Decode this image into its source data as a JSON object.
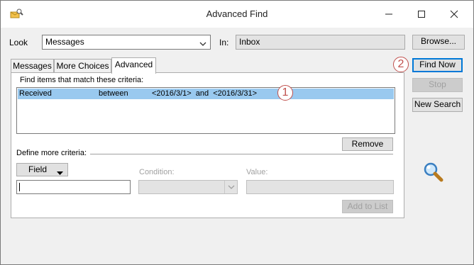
{
  "window": {
    "title": "Advanced Find"
  },
  "look": {
    "label": "Look",
    "value": "Messages"
  },
  "in": {
    "label": "In:",
    "value": "Inbox"
  },
  "buttons": {
    "browse": "Browse...",
    "find_now": "Find Now",
    "stop": "Stop",
    "new_search": "New Search",
    "remove": "Remove",
    "field": "Field",
    "add_to_list": "Add to List"
  },
  "tabs": [
    {
      "label": "Messages"
    },
    {
      "label": "More Choices"
    },
    {
      "label": "Advanced"
    }
  ],
  "criteria": {
    "heading": "Find items that match these criteria:",
    "rows": [
      {
        "field": "Received",
        "condition": "between",
        "value": "<2016/3/1>  and  <2016/3/31>"
      }
    ]
  },
  "define": {
    "heading": "Define more criteria:",
    "condition_label": "Condition:",
    "value_label": "Value:"
  },
  "annotations": {
    "step1": "1",
    "step2": "2"
  },
  "colors": {
    "accent": "#0078d7",
    "selection": "#99c9ef",
    "annotation": "#c0504d"
  }
}
